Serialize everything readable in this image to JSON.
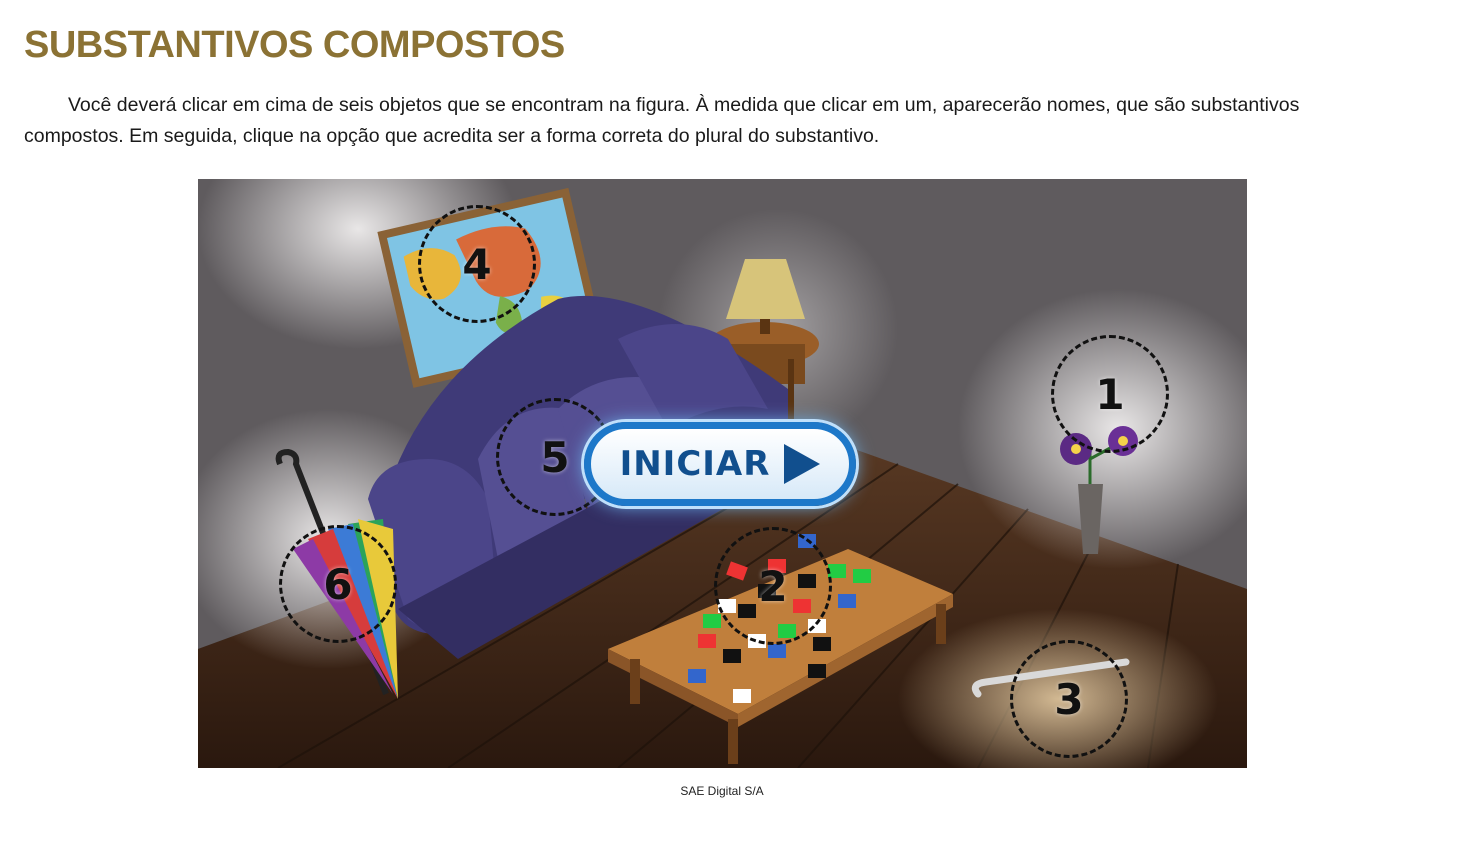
{
  "page": {
    "title": "SUBSTANTIVOS COMPOSTOS",
    "instructions": "Você deverá clicar em cima de seis objetos que se encontram na figura. À medida que clicar em um, aparecerão nomes, que são substantivos compostos. Em seguida, clique na opção que acredita ser a forma correta do plural do substantivo.",
    "credit": "SAE Digital S/A"
  },
  "scene": {
    "start_button": {
      "label": "INICIAR",
      "icon": "play-icon"
    },
    "hotspots": [
      {
        "number": "1",
        "object": "flower-vase"
      },
      {
        "number": "2",
        "object": "puzzle-pieces"
      },
      {
        "number": "3",
        "object": "walking-cane"
      },
      {
        "number": "4",
        "object": "world-map"
      },
      {
        "number": "5",
        "object": "sofa-cushion"
      },
      {
        "number": "6",
        "object": "umbrella"
      }
    ]
  },
  "colors": {
    "title": "#8b7234",
    "button_border": "#1d78c9",
    "button_text": "#114f8e"
  }
}
